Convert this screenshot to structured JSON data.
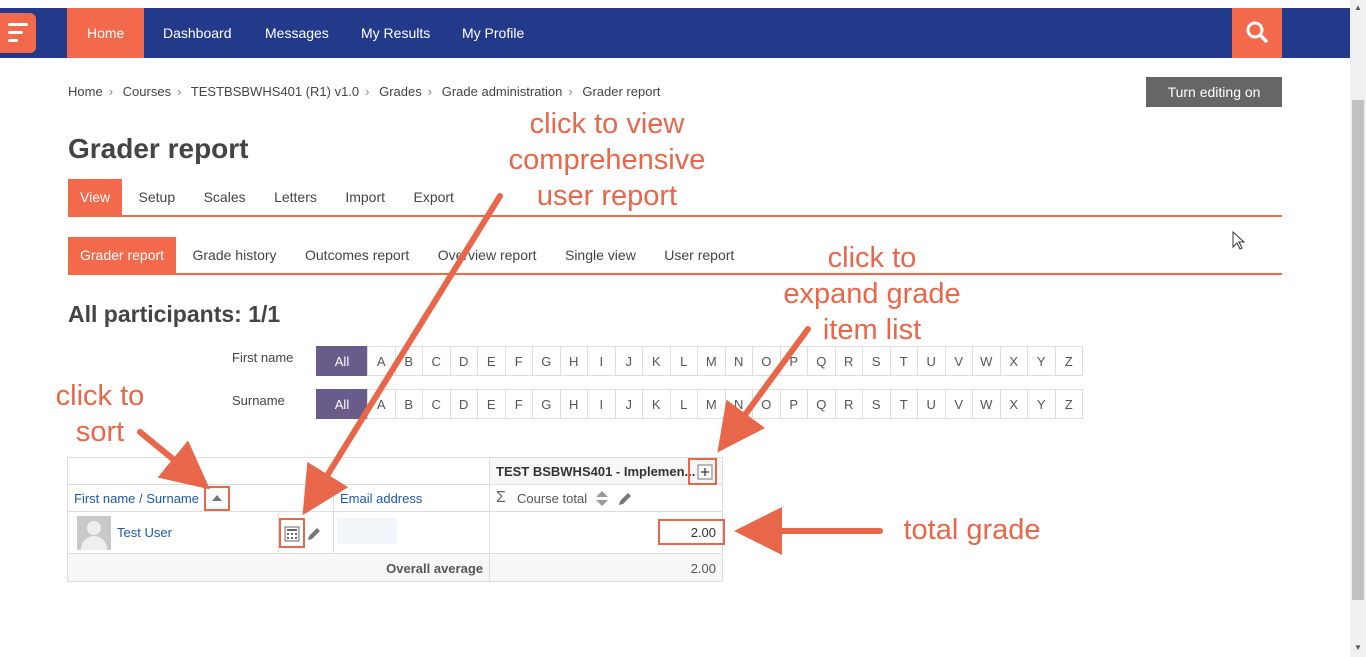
{
  "nav": {
    "items": [
      "Home",
      "Dashboard",
      "Messages",
      "My Results",
      "My Profile"
    ]
  },
  "breadcrumb": [
    "Home",
    "Courses",
    "TESTBSBWHS401 (R1) v1.0",
    "Grades",
    "Grade administration",
    "Grader report"
  ],
  "edit_button": "Turn editing on",
  "page_title": "Grader report",
  "tabs_main": [
    "View",
    "Setup",
    "Scales",
    "Letters",
    "Import",
    "Export"
  ],
  "tabs_sub": [
    "Grader report",
    "Grade history",
    "Outcomes report",
    "Overview report",
    "Single view",
    "User report"
  ],
  "participants_heading": "All participants: 1/1",
  "filters": {
    "first_name_label": "First name",
    "surname_label": "Surname",
    "all_label": "All",
    "letters": [
      "A",
      "B",
      "C",
      "D",
      "E",
      "F",
      "G",
      "H",
      "I",
      "J",
      "K",
      "L",
      "M",
      "N",
      "O",
      "P",
      "Q",
      "R",
      "S",
      "T",
      "U",
      "V",
      "W",
      "X",
      "Y",
      "Z"
    ]
  },
  "table": {
    "category_header": "TEST BSBWHS401 - Implemen...",
    "col_name": "First name / Surname",
    "col_email": "Email address",
    "col_total": "Course total",
    "user_name": "Test User",
    "user_total": "2.00",
    "overall_label": "Overall average",
    "overall_value": "2.00"
  },
  "annotations": {
    "user_report": "click to view\ncomprehensive\nuser report",
    "expand": "click to\nexpand grade\nitem list",
    "sort": "click to\nsort",
    "total": "total grade"
  },
  "colors": {
    "nav": "#233a8b",
    "accent": "#f26a4b",
    "all_button": "#6a5c8a",
    "annotation": "#e8674a"
  }
}
